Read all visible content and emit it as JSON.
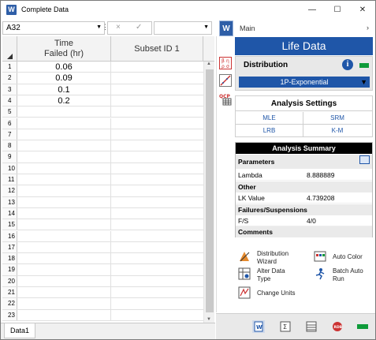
{
  "window": {
    "title": "Complete Data",
    "app_icon_letter": "W",
    "minimize": "—",
    "maximize": "☐",
    "close": "✕"
  },
  "formula_bar": {
    "cell_ref": "A32",
    "cancel_icon": "×",
    "confirm_icon": "✓"
  },
  "grid": {
    "columns": [
      "Time Failed (hr)",
      "Subset ID 1"
    ],
    "column1_line1": "Time",
    "column1_line2": "Failed (hr)",
    "rows": [
      {
        "num": "1",
        "value": "0.06"
      },
      {
        "num": "2",
        "value": "0.09"
      },
      {
        "num": "3",
        "value": "0.1"
      },
      {
        "num": "4",
        "value": "0.2"
      },
      {
        "num": "5",
        "value": ""
      },
      {
        "num": "6",
        "value": ""
      },
      {
        "num": "7",
        "value": ""
      },
      {
        "num": "8",
        "value": ""
      },
      {
        "num": "9",
        "value": ""
      },
      {
        "num": "10",
        "value": ""
      },
      {
        "num": "11",
        "value": ""
      },
      {
        "num": "12",
        "value": ""
      },
      {
        "num": "13",
        "value": ""
      },
      {
        "num": "14",
        "value": ""
      },
      {
        "num": "15",
        "value": ""
      },
      {
        "num": "16",
        "value": ""
      },
      {
        "num": "17",
        "value": ""
      },
      {
        "num": "18",
        "value": ""
      },
      {
        "num": "19",
        "value": ""
      },
      {
        "num": "20",
        "value": ""
      },
      {
        "num": "21",
        "value": ""
      },
      {
        "num": "22",
        "value": ""
      },
      {
        "num": "23",
        "value": ""
      }
    ]
  },
  "sheet_tabs": [
    "Data1"
  ],
  "panel": {
    "main_label": "Main",
    "main_icon_letter": "W",
    "header": "Life Data",
    "distribution": {
      "label": "Distribution",
      "info": "i",
      "selected": "1P-Exponential"
    },
    "analysis_settings": {
      "title": "Analysis Settings",
      "options": [
        "MLE",
        "SRM",
        "LRB",
        "K-M"
      ]
    },
    "analysis_summary": {
      "title": "Analysis Summary",
      "parameters_label": "Parameters",
      "lambda_label": "Lambda",
      "lambda_value": "8.888889",
      "other_label": "Other",
      "lk_label": "LK Value",
      "lk_value": "4.739208",
      "fs_section": "Failures/Suspensions",
      "fs_label": "F/S",
      "fs_value": "4/0",
      "comments_label": "Comments"
    },
    "tools": {
      "distribution_wizard_1": "Distribution",
      "distribution_wizard_2": "Wizard",
      "auto_color": "Auto Color",
      "alter_data_type_1": "Alter Data",
      "alter_data_type_2": "Type",
      "batch_auto_run_1": "Batch Auto",
      "batch_auto_run_2": "Run",
      "change_units": "Change Units"
    },
    "colors": {
      "accent": "#1f56a8",
      "green": "#0e9b3a"
    }
  }
}
